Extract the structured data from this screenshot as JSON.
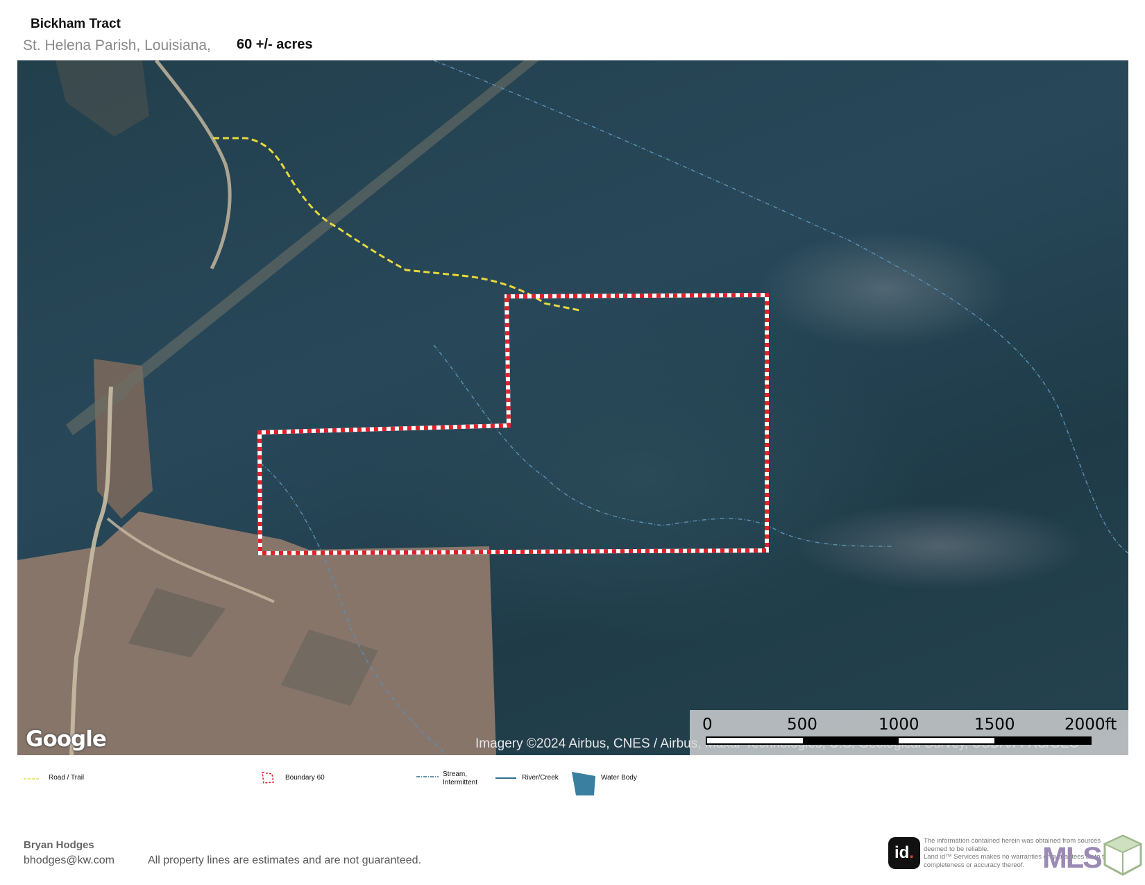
{
  "header": {
    "title": "Bickham Tract",
    "location": "St. Helena Parish, Louisiana,",
    "acreage": "60 +/- acres"
  },
  "map": {
    "attribution_logo": "Google",
    "imagery_credit": "Imagery ©2024 Airbus, CNES / Airbus, Maxar Technologies, U.S. Geological Survey, USDA/FPAC/GEO",
    "scale": {
      "labels": [
        "0",
        "500",
        "1000",
        "1500",
        "2000ft"
      ],
      "max_ft": 2000
    },
    "colors": {
      "forest": "#223f4c",
      "clearcut": "#8a7466",
      "boundary": "#e0202a",
      "road_trail": "#e8d83a",
      "stream": "#5a8fb0",
      "river": "#2f6e8e",
      "water_body": "#3a7f9f"
    }
  },
  "legend": {
    "road_trail": "Road / Trail",
    "boundary": "Boundary 60",
    "stream": "Stream,",
    "stream_line2": "Intermittent",
    "river": "River/Creek",
    "water_body": "Water Body"
  },
  "footer": {
    "agent_name": "Bryan Hodges",
    "agent_email": "bhodges@kw.com",
    "disclaimer": "All property lines are estimates and are not guaranteed.",
    "landid_logo": "id",
    "landid_notice_1": "The information contained herein was obtained from sources deemed to be reliable.",
    "landid_notice_2": "Land id™ Services makes no warranties or guarantees as to the completeness or accuracy thereof.",
    "mls_logo": "MLS"
  }
}
